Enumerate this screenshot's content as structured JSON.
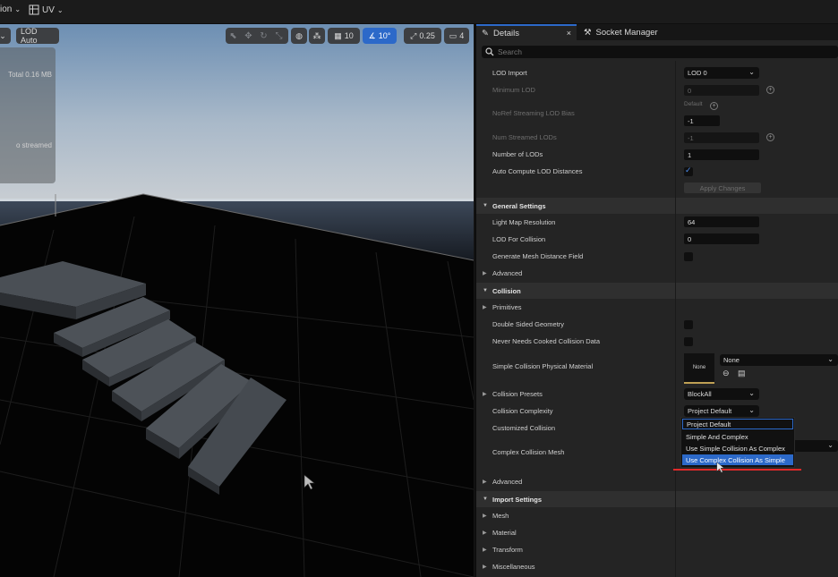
{
  "topbar": {
    "left_label": "ion",
    "uv_label": "UV"
  },
  "viewport": {
    "lod_label": "LOD Auto",
    "grid_snap": "10",
    "rotation_snap": "10°",
    "scale_snap": "0.25",
    "camera_speed": "4",
    "stats_line1": "Total 0.16 MB",
    "stats_line2": "o streamed"
  },
  "tabs": {
    "details": "Details",
    "socket_manager": "Socket Manager"
  },
  "search": {
    "placeholder": "Search"
  },
  "rows": {
    "lod_import": {
      "label": "LOD Import",
      "value": "LOD 0"
    },
    "minimum_lod": {
      "label": "Minimum LOD",
      "value": "0"
    },
    "noref_bias": {
      "label": "NoRef Streaming LOD Bias",
      "caption": "Default",
      "value": "-1"
    },
    "num_streamed": {
      "label": "Num Streamed LODs",
      "value": "-1"
    },
    "num_lods": {
      "label": "Number of LODs",
      "value": "1"
    },
    "auto_compute": {
      "label": "Auto Compute LOD Distances",
      "checked": true
    },
    "apply_changes": "Apply Changes",
    "general_settings": "General Settings",
    "light_map": {
      "label": "Light Map Resolution",
      "value": "64"
    },
    "lod_collision": {
      "label": "LOD For Collision",
      "value": "0"
    },
    "gen_mesh_df": {
      "label": "Generate Mesh Distance Field",
      "checked": false
    },
    "advanced1": "Advanced",
    "collision": "Collision",
    "primitives": "Primitives",
    "double_sided": {
      "label": "Double Sided Geometry",
      "checked": false
    },
    "never_cooked": {
      "label": "Never Needs Cooked Collision Data",
      "checked": false
    },
    "simple_phys_mat": {
      "label": "Simple Collision Physical Material",
      "value": "None",
      "thumb": "None"
    },
    "collision_presets": {
      "label": "Collision Presets",
      "value": "BlockAll"
    },
    "collision_complexity": {
      "label": "Collision Complexity",
      "value": "Project Default"
    },
    "customized_collision": {
      "label": "Customized Collision"
    },
    "complex_mesh": {
      "label": "Complex Collision Mesh"
    },
    "advanced2": "Advanced",
    "import_settings": "Import Settings",
    "mesh": "Mesh",
    "material": "Material",
    "transform": "Transform",
    "misc": "Miscellaneous"
  },
  "dropdown": {
    "options": [
      "Project Default",
      "Simple And Complex",
      "Use Simple Collision As Complex",
      "Use Complex Collision As Simple"
    ]
  },
  "colors": {
    "accent": "#2c69c9",
    "highlight_line": "#e02a2a",
    "thumb_border": "#bfa054"
  }
}
